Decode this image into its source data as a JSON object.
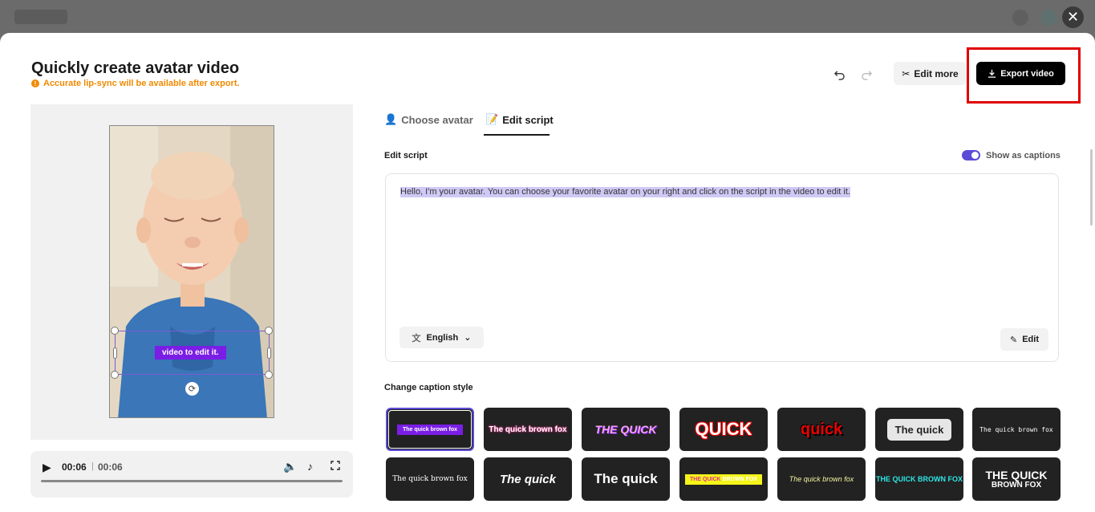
{
  "modal": {
    "title": "Quickly create avatar video",
    "notice": "Accurate lip-sync will be available after export.",
    "edit_more_label": "Edit more",
    "export_label": "Export video"
  },
  "tabs": [
    {
      "label": "Choose avatar",
      "active": false
    },
    {
      "label": "Edit script",
      "active": true
    }
  ],
  "script": {
    "section_label": "Edit script",
    "captions_toggle_label": "Show as captions",
    "captions_enabled": true,
    "text": "Hello, I'm your avatar. You can choose your favorite avatar on your right and click on the script in the video to edit it.",
    "language": "English",
    "edit_label": "Edit"
  },
  "preview": {
    "caption_text": "video to edit it.",
    "current_time": "00:06",
    "total_time": "00:06"
  },
  "caption_styles": {
    "section_label": "Change caption style",
    "items": [
      {
        "text": "The quick brown fox",
        "selected": true
      },
      {
        "text": "The quick brown fox"
      },
      {
        "text": "THE QUICK"
      },
      {
        "text": "QUICK"
      },
      {
        "text": "quick"
      },
      {
        "text": "The quick"
      },
      {
        "text": "The quick brown fox"
      },
      {
        "text": "The quick brown fox"
      },
      {
        "text": "The quick"
      },
      {
        "text": "The quick"
      },
      {
        "text_highlight": "THE QUICK",
        "text_rest": "BROWN FOX"
      },
      {
        "text": "The quick brown fox"
      },
      {
        "text": "THE QUICK BROWN FOX"
      },
      {
        "text_line1": "THE QUICK",
        "text_line2": "BROWN FOX"
      }
    ]
  },
  "colors": {
    "accent": "#5b4bd6",
    "caption_purple": "#7a1ee6",
    "notice_orange": "#f08a00",
    "highlight_red": "#e00000"
  },
  "icons": {
    "close": "close-icon",
    "undo": "undo-icon",
    "redo": "redo-icon",
    "scissors": "scissors-icon",
    "download": "download-icon",
    "play": "play-icon",
    "volume": "volume-icon",
    "tiktok": "tiktok-icon",
    "fullscreen": "fullscreen-icon",
    "translate": "translate-icon",
    "chevron_down": "chevron-down-icon",
    "pencil": "pencil-icon"
  }
}
